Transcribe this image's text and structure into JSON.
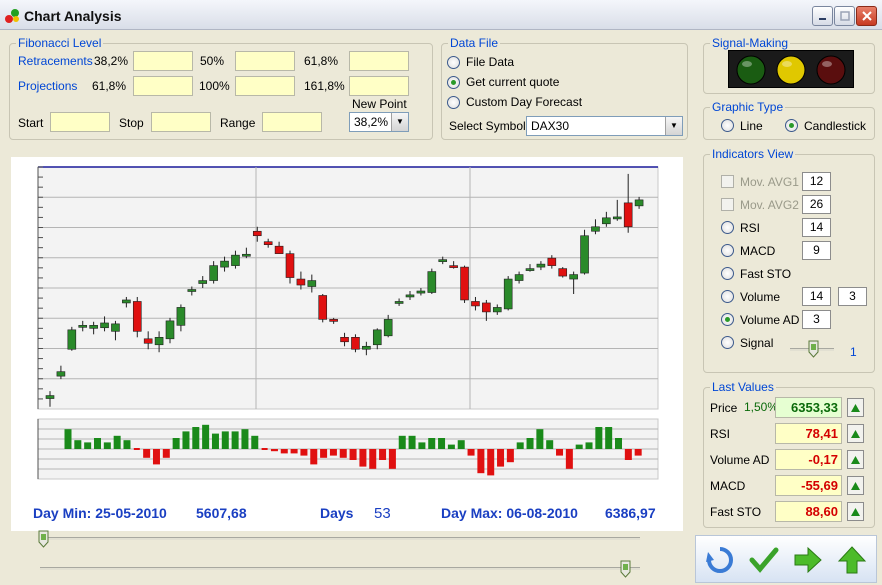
{
  "window": {
    "title": "Chart Analysis"
  },
  "fibonacci": {
    "legend": "Fibonacci Level",
    "retracements_label": "Retracements",
    "projections_label": "Projections",
    "retr_levels": [
      "38,2%",
      "50%",
      "61,8%"
    ],
    "proj_levels": [
      "61,8%",
      "100%",
      "161,8%"
    ],
    "new_point_label": "New Point",
    "start_label": "Start",
    "stop_label": "Stop",
    "range_label": "Range",
    "new_point_value": "38,2%"
  },
  "data_file": {
    "legend": "Data File",
    "options": [
      "File Data",
      "Get current quote",
      "Custom Day Forecast"
    ],
    "selected_index": 1,
    "select_symbol_label": "Select Symbol",
    "symbol_value": "DAX30"
  },
  "signal": {
    "legend": "Signal-Making",
    "lights": [
      "#1a5c12",
      "#e0c800",
      "#5a0e0e"
    ]
  },
  "graphic_type": {
    "legend": "Graphic Type",
    "options": [
      "Line",
      "Candlestick"
    ],
    "selected_index": 1
  },
  "indicators": {
    "legend": "Indicators View",
    "items": [
      {
        "label": "Mov. AVG1",
        "control": "checkbox",
        "enabled": false,
        "values": [
          "12"
        ]
      },
      {
        "label": "Mov. AVG2",
        "control": "checkbox",
        "enabled": false,
        "values": [
          "26"
        ]
      },
      {
        "label": "RSI",
        "control": "radio",
        "checked": false,
        "values": [
          "14"
        ]
      },
      {
        "label": "MACD",
        "control": "radio",
        "checked": false,
        "values": [
          "9"
        ]
      },
      {
        "label": "Fast STO",
        "control": "radio",
        "checked": false,
        "values": []
      },
      {
        "label": "Volume",
        "control": "radio",
        "checked": false,
        "values": [
          "14",
          "3"
        ]
      },
      {
        "label": "Volume AD",
        "control": "radio",
        "checked": true,
        "values": [
          "3"
        ]
      },
      {
        "label": "Signal",
        "control": "radio",
        "checked": false,
        "values": []
      }
    ],
    "signal_slider_value": "1"
  },
  "last_values": {
    "legend": "Last Values",
    "price_change": "1,50%",
    "items": [
      {
        "label": "Price",
        "value": "6353,33",
        "color": "#0a6a0a",
        "bg": "#e6ffd2"
      },
      {
        "label": "RSI",
        "value": "78,41",
        "color": "#d40000",
        "bg": "#ffffc6"
      },
      {
        "label": "Volume AD",
        "value": "-0,17",
        "color": "#d40000",
        "bg": "#ffffc6"
      },
      {
        "label": "MACD",
        "value": "-55,69",
        "color": "#d40000",
        "bg": "#ffffc6"
      },
      {
        "label": "Fast STO",
        "value": "88,60",
        "color": "#d40000",
        "bg": "#ffffc6"
      }
    ]
  },
  "summary": {
    "day_min_label": "Day Min: 25-05-2010",
    "day_min_value": "5607,68",
    "days_label": "Days",
    "days_value": "53",
    "day_max_label": "Day Max: 06-08-2010",
    "day_max_value": "6386,97"
  },
  "toolbar": [
    "refresh-icon",
    "check-icon",
    "forward-arrow-icon",
    "up-arrow-icon"
  ],
  "chart_data": {
    "type": "candlestick",
    "title": "",
    "price_range": [
      5607.68,
      6386.97
    ],
    "candles": [
      {
        "o": 5635,
        "c": 5645,
        "h": 5660,
        "l": 5607.68
      },
      {
        "o": 5710,
        "c": 5725,
        "h": 5745,
        "l": 5700
      },
      {
        "o": 5800,
        "c": 5865,
        "h": 5875,
        "l": 5795
      },
      {
        "o": 5875,
        "c": 5880,
        "h": 5895,
        "l": 5860
      },
      {
        "o": 5870,
        "c": 5880,
        "h": 5892,
        "l": 5850
      },
      {
        "o": 5872,
        "c": 5888,
        "h": 5910,
        "l": 5860
      },
      {
        "o": 5860,
        "c": 5885,
        "h": 5895,
        "l": 5830
      },
      {
        "o": 5955,
        "c": 5965,
        "h": 5975,
        "l": 5940
      },
      {
        "o": 5960,
        "c": 5860,
        "h": 5975,
        "l": 5840
      },
      {
        "o": 5835,
        "c": 5820,
        "h": 5860,
        "l": 5800
      },
      {
        "o": 5815,
        "c": 5840,
        "h": 5860,
        "l": 5790
      },
      {
        "o": 5835,
        "c": 5895,
        "h": 5905,
        "l": 5820
      },
      {
        "o": 5880,
        "c": 5940,
        "h": 5950,
        "l": 5860
      },
      {
        "o": 5995,
        "c": 6000,
        "h": 6010,
        "l": 5980
      },
      {
        "o": 6020,
        "c": 6030,
        "h": 6045,
        "l": 6005
      },
      {
        "o": 6030,
        "c": 6080,
        "h": 6095,
        "l": 6020
      },
      {
        "o": 6075,
        "c": 6095,
        "h": 6110,
        "l": 6060
      },
      {
        "o": 6080,
        "c": 6115,
        "h": 6130,
        "l": 6070
      },
      {
        "o": 6115,
        "c": 6118,
        "h": 6140,
        "l": 6105
      },
      {
        "o": 6195,
        "c": 6180,
        "h": 6210,
        "l": 6160
      },
      {
        "o": 6160,
        "c": 6150,
        "h": 6170,
        "l": 6140
      },
      {
        "o": 6145,
        "c": 6120,
        "h": 6160,
        "l": 6120
      },
      {
        "o": 6120,
        "c": 6040,
        "h": 6130,
        "l": 6020
      },
      {
        "o": 6035,
        "c": 6015,
        "h": 6060,
        "l": 6000
      },
      {
        "o": 6010,
        "c": 6030,
        "h": 6050,
        "l": 5990
      },
      {
        "o": 5980,
        "c": 5900,
        "h": 5985,
        "l": 5890
      },
      {
        "o": 5900,
        "c": 5895,
        "h": 5905,
        "l": 5885
      },
      {
        "o": 5840,
        "c": 5825,
        "h": 5855,
        "l": 5810
      },
      {
        "o": 5840,
        "c": 5800,
        "h": 5850,
        "l": 5790
      },
      {
        "o": 5800,
        "c": 5810,
        "h": 5825,
        "l": 5780
      },
      {
        "o": 5815,
        "c": 5865,
        "h": 5870,
        "l": 5800
      },
      {
        "o": 5845,
        "c": 5900,
        "h": 5915,
        "l": 5840
      },
      {
        "o": 5955,
        "c": 5960,
        "h": 5970,
        "l": 5945
      },
      {
        "o": 5975,
        "c": 5982,
        "h": 5995,
        "l": 5965
      },
      {
        "o": 5988,
        "c": 5995,
        "h": 6005,
        "l": 5980
      },
      {
        "o": 5990,
        "c": 6060,
        "h": 6070,
        "l": 5985
      },
      {
        "o": 6095,
        "c": 6100,
        "h": 6110,
        "l": 6085
      },
      {
        "o": 6080,
        "c": 6075,
        "h": 6095,
        "l": 6070
      },
      {
        "o": 6075,
        "c": 5965,
        "h": 6080,
        "l": 5955
      },
      {
        "o": 5960,
        "c": 5945,
        "h": 5975,
        "l": 5930
      },
      {
        "o": 5955,
        "c": 5925,
        "h": 5965,
        "l": 5895
      },
      {
        "o": 5925,
        "c": 5940,
        "h": 5950,
        "l": 5915
      },
      {
        "o": 5935,
        "c": 6035,
        "h": 6045,
        "l": 5930
      },
      {
        "o": 6030,
        "c": 6050,
        "h": 6060,
        "l": 6020
      },
      {
        "o": 6065,
        "c": 6070,
        "h": 6085,
        "l": 6060
      },
      {
        "o": 6075,
        "c": 6085,
        "h": 6095,
        "l": 6065
      },
      {
        "o": 6105,
        "c": 6080,
        "h": 6115,
        "l": 6070
      },
      {
        "o": 6070,
        "c": 6045,
        "h": 6075,
        "l": 6040
      },
      {
        "o": 6035,
        "c": 6050,
        "h": 6060,
        "l": 5985
      },
      {
        "o": 6055,
        "c": 6180,
        "h": 6200,
        "l": 6050
      },
      {
        "o": 6195,
        "c": 6210,
        "h": 6235,
        "l": 6185
      },
      {
        "o": 6220,
        "c": 6240,
        "h": 6260,
        "l": 6210
      },
      {
        "o": 6240,
        "c": 6243,
        "h": 6300,
        "l": 6230
      },
      {
        "o": 6290,
        "c": 6210,
        "h": 6386.97,
        "l": 6190
      },
      {
        "o": 6280,
        "c": 6300,
        "h": 6310,
        "l": 6270
      }
    ],
    "volume_ad": [
      0.9,
      0.4,
      0.3,
      0.5,
      0.3,
      0.6,
      0.4,
      0,
      -0.4,
      -0.7,
      -0.4,
      0.5,
      0.8,
      1.0,
      1.1,
      0.7,
      0.8,
      0.8,
      0.9,
      0.6,
      0,
      -0.1,
      -0.2,
      -0.2,
      -0.3,
      -0.7,
      -0.4,
      -0.3,
      -0.4,
      -0.5,
      -0.8,
      -0.9,
      -0.5,
      -0.9,
      0.6,
      0.6,
      0.3,
      0.5,
      0.5,
      0.2,
      0.4,
      -0.3,
      -1.1,
      -1.2,
      -0.8,
      -0.6,
      0.3,
      0.5,
      0.9,
      0.4,
      -0.3,
      -0.9,
      0.2,
      0.3,
      1.0,
      1.0,
      0.5,
      -0.5,
      -0.3
    ]
  }
}
